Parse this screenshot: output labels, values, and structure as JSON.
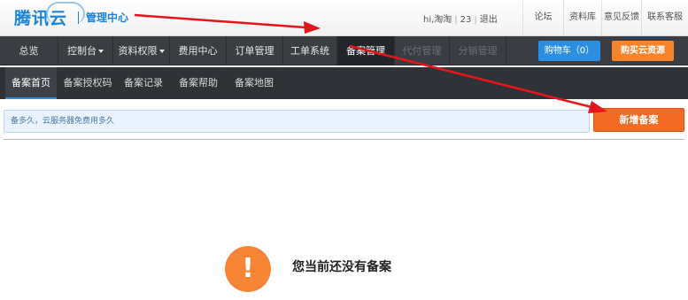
{
  "header": {
    "logo_text": "腾讯云",
    "subtitle": "管理中心",
    "greeting": "hi,淘淘",
    "count": "23",
    "logout": "退出",
    "links": [
      "论坛",
      "资料库",
      "意见反馈",
      "联系客服"
    ]
  },
  "nav": {
    "items": [
      {
        "label": "总览"
      },
      {
        "label": "控制台"
      },
      {
        "label": "资料权限"
      },
      {
        "label": "费用中心"
      },
      {
        "label": "订单管理"
      },
      {
        "label": "工单系统"
      },
      {
        "label": "备案管理"
      },
      {
        "label": "代付管理"
      },
      {
        "label": "分销管理"
      }
    ],
    "cart_label": "购物车（0）",
    "buy_label": "购买云资源"
  },
  "subnav": {
    "items": [
      {
        "label": "备案首页"
      },
      {
        "label": "备案授权码"
      },
      {
        "label": "备案记录"
      },
      {
        "label": "备案帮助"
      },
      {
        "label": "备案地图"
      }
    ]
  },
  "notice": {
    "text": "备多久，云服务器免费用多久"
  },
  "actions": {
    "add_label": "新增备案"
  },
  "empty_state": {
    "icon_text": "!",
    "message": "您当前还没有备案"
  },
  "colors": {
    "accent_blue": "#2c8ee0",
    "accent_orange": "#f26a23",
    "nav_bg": "#3a3d42",
    "annotation_red": "#e8141b"
  }
}
